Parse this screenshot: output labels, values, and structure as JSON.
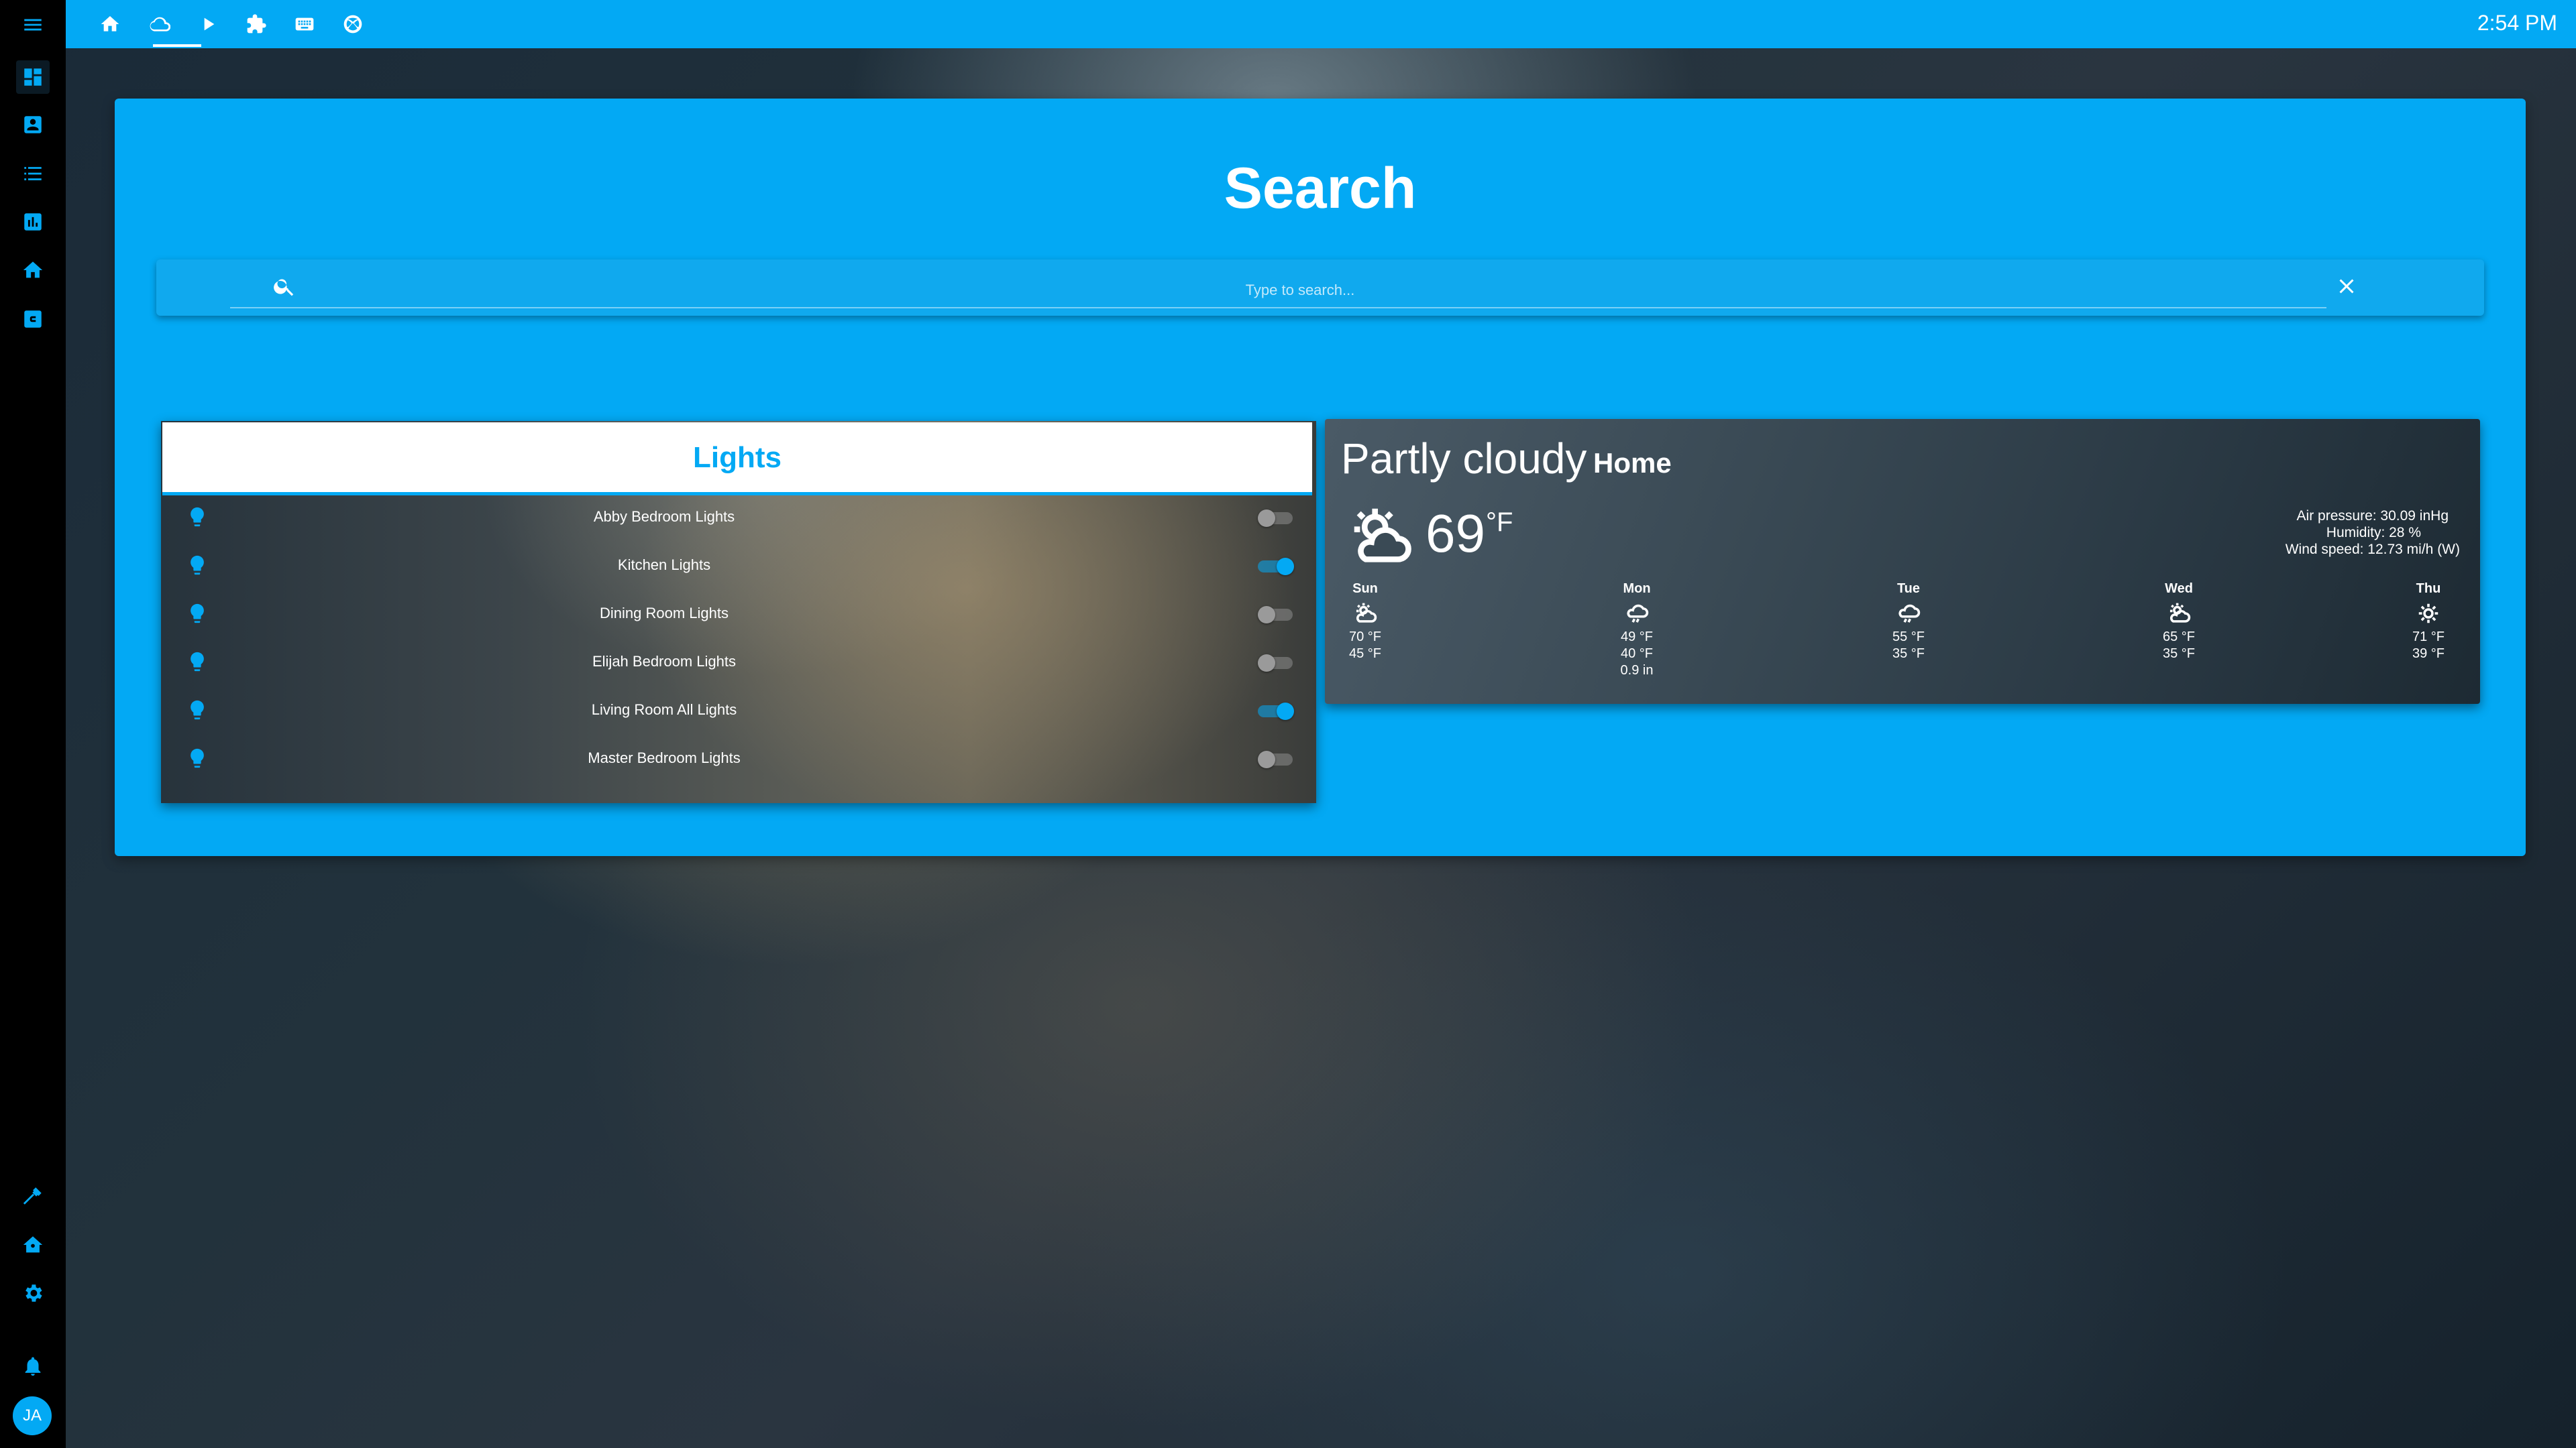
{
  "topbar": {
    "clock": "2:54 PM",
    "tabs": [
      {
        "icon": "home-icon",
        "name": "tab-home"
      },
      {
        "icon": "cloud-icon",
        "name": "tab-weather"
      },
      {
        "icon": "play-icon",
        "name": "tab-media"
      },
      {
        "icon": "puzzle-icon",
        "name": "tab-devices"
      },
      {
        "icon": "keyboard-icon",
        "name": "tab-remote"
      },
      {
        "icon": "xbox-icon",
        "name": "tab-xbox"
      }
    ]
  },
  "sidebar": {
    "items": [
      {
        "icon": "menu-icon"
      },
      {
        "icon": "dashboard-icon"
      },
      {
        "icon": "account-box-icon"
      },
      {
        "icon": "list-icon"
      },
      {
        "icon": "chart-icon"
      },
      {
        "icon": "home-icon"
      },
      {
        "icon": "calendar-icon"
      },
      {
        "icon": "hammer-icon"
      },
      {
        "icon": "home-automation-icon"
      },
      {
        "icon": "gear-icon"
      },
      {
        "icon": "bell-icon"
      }
    ],
    "avatar": "JA"
  },
  "search": {
    "title": "Search",
    "placeholder": "Type to search..."
  },
  "lights": {
    "title": "Lights",
    "items": [
      {
        "label": "Abby Bedroom Lights",
        "on": false
      },
      {
        "label": "Kitchen Lights",
        "on": true
      },
      {
        "label": "Dining Room Lights",
        "on": false
      },
      {
        "label": "Elijah Bedroom Lights",
        "on": false
      },
      {
        "label": "Living Room All Lights",
        "on": true
      },
      {
        "label": "Master Bedroom Lights",
        "on": false
      }
    ]
  },
  "weather": {
    "state": "Partly cloudy",
    "location": "Home",
    "temperature": "69",
    "unit": "°F",
    "icon": "partly-cloudy-icon",
    "attributes": {
      "pressure": "Air pressure: 30.09 inHg",
      "humidity": "Humidity: 28 %",
      "wind": "Wind speed: 12.73 mi/h (W)"
    },
    "forecast": [
      {
        "day": "Sun",
        "icon": "partly-cloudy-icon",
        "high": "70 °F",
        "low": "45 °F",
        "precip": ""
      },
      {
        "day": "Mon",
        "icon": "rainy-icon",
        "high": "49 °F",
        "low": "40 °F",
        "precip": "0.9 in"
      },
      {
        "day": "Tue",
        "icon": "rainy-icon",
        "high": "55 °F",
        "low": "35 °F",
        "precip": ""
      },
      {
        "day": "Wed",
        "icon": "partly-cloudy-icon",
        "high": "65 °F",
        "low": "35 °F",
        "precip": ""
      },
      {
        "day": "Thu",
        "icon": "sunny-icon",
        "high": "71 °F",
        "low": "39 °F",
        "precip": ""
      }
    ]
  },
  "colors": {
    "accent": "#03a9f4",
    "sidebar": "#000000",
    "header_bg": "#ffffff"
  }
}
